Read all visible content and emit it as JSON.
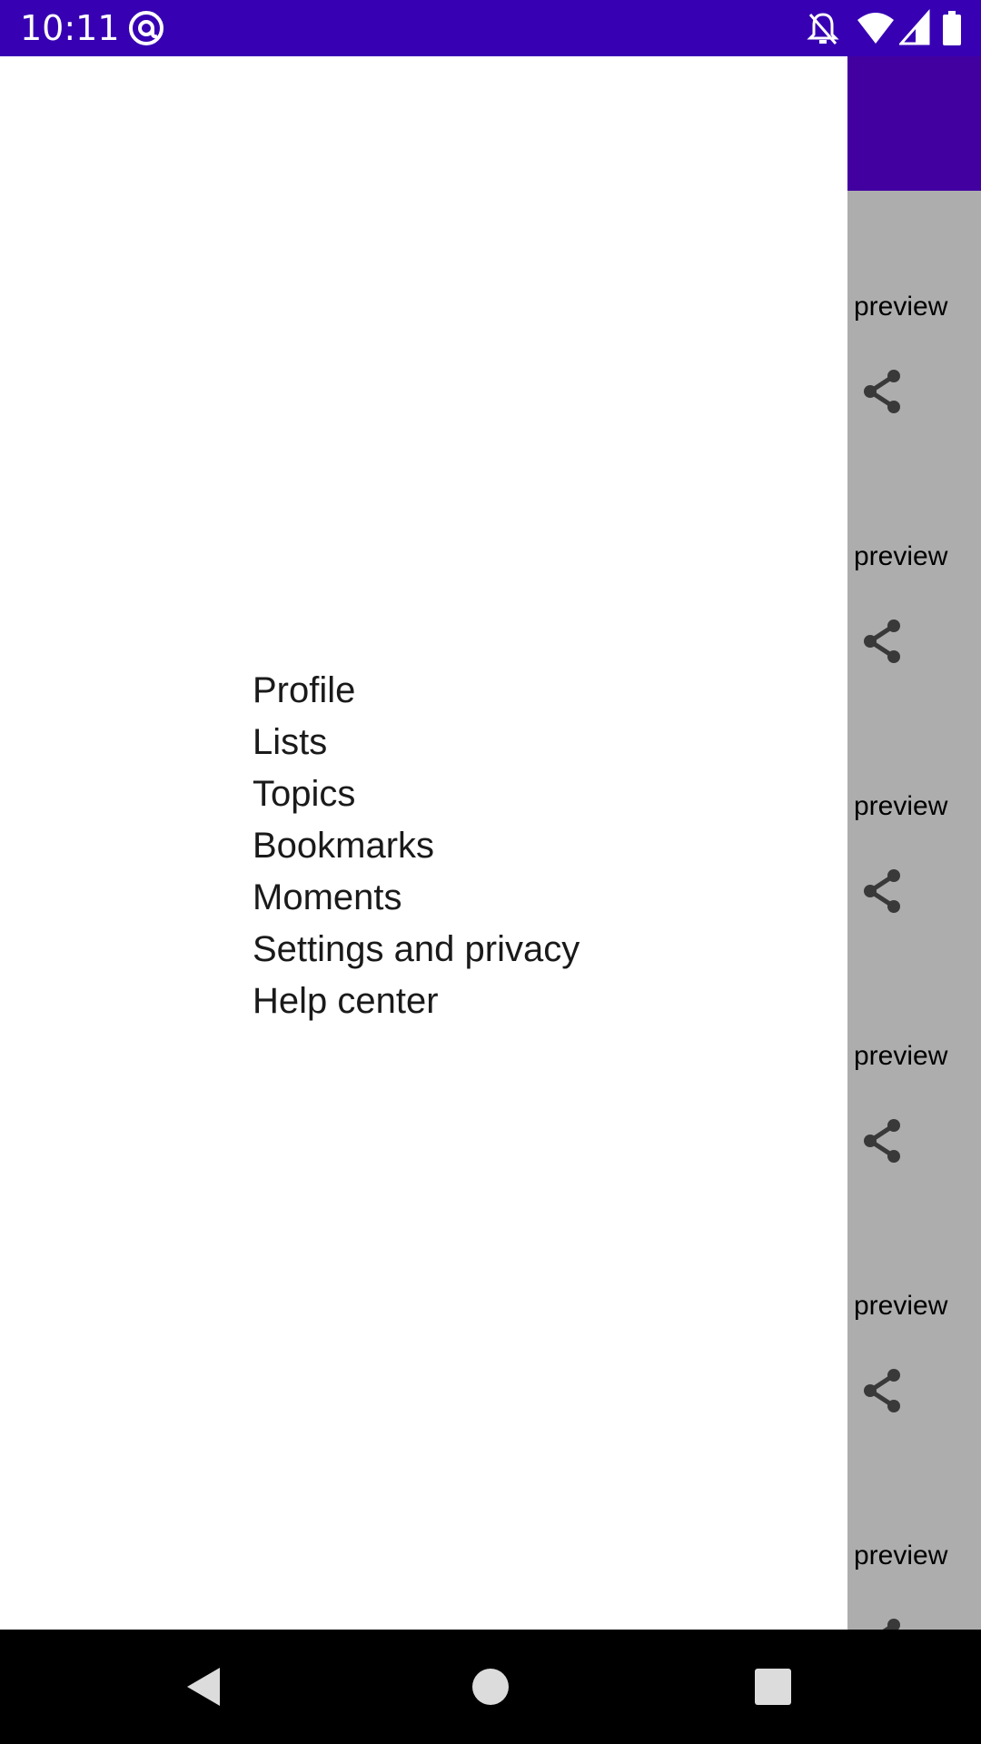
{
  "status_bar": {
    "time": "10:11",
    "icons": [
      "at-sign-icon",
      "notifications-off-icon",
      "wifi-icon",
      "cell-signal-icon",
      "battery-icon"
    ],
    "background": "#3700b3"
  },
  "app": {
    "toolbar_color": "#6200ee",
    "feed": {
      "items": [
        {
          "preview": "preview"
        },
        {
          "preview": "preview"
        },
        {
          "preview": "preview"
        },
        {
          "preview": "preview"
        },
        {
          "preview": "preview"
        },
        {
          "preview": "preview"
        }
      ]
    }
  },
  "drawer": {
    "items": [
      {
        "label": "Profile"
      },
      {
        "label": "Lists"
      },
      {
        "label": "Topics"
      },
      {
        "label": "Bookmarks"
      },
      {
        "label": "Moments"
      },
      {
        "label": "Settings and privacy"
      },
      {
        "label": "Help center"
      }
    ]
  },
  "nav_bar": {
    "buttons": [
      "back-icon",
      "home-icon",
      "recents-icon"
    ]
  }
}
